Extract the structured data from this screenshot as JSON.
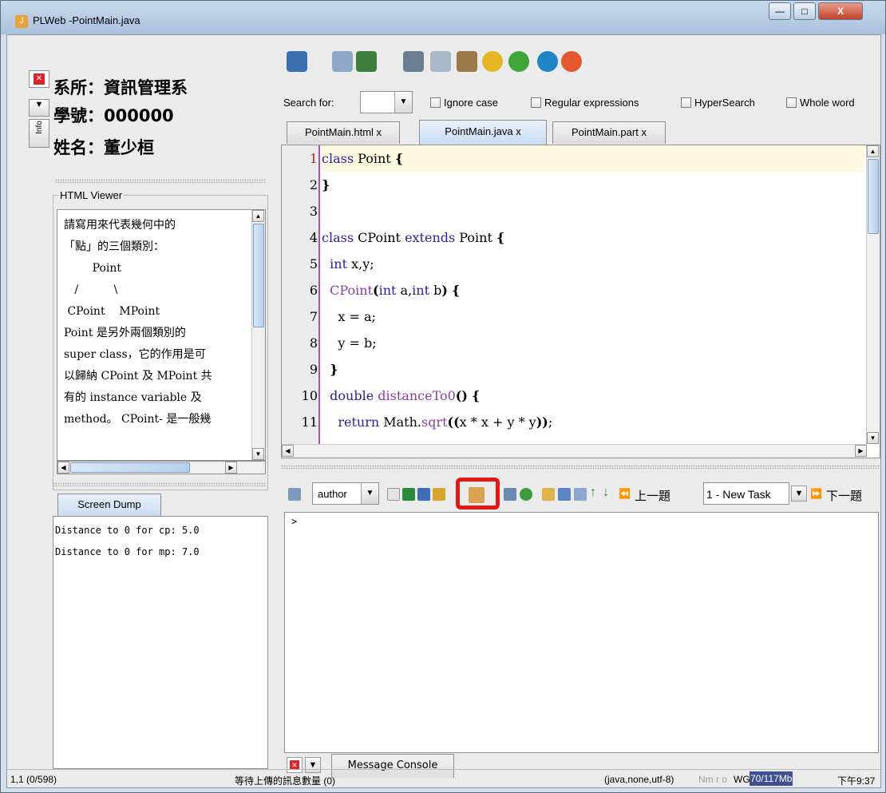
{
  "window": {
    "title": "PLWeb -PointMain.java",
    "min": "—",
    "max": "□",
    "close": "X"
  },
  "info": {
    "dept_label": "系所：",
    "dept": "資訊管理系",
    "id_label": "學號：",
    "id": "000000",
    "name_label": "姓名：",
    "name": "董少桓",
    "info_tab": "Info"
  },
  "html_viewer": {
    "label": "HTML Viewer",
    "lines": [
      "請寫用來代表幾何中的",
      "「點」的三個類別：",
      "        Point",
      "   /          \\",
      " CPoint    MPoint",
      "Point 是另外兩個類別的",
      "super class，它的作用是可",
      "以歸納 CPoint 及 MPoint 共",
      "有的 instance variable 及",
      "method。 CPoint- 是一般幾"
    ]
  },
  "screen_dump": {
    "tab": "Screen Dump",
    "lines": [
      "Distance to 0 for cp: 5.0",
      "Distance to 0 for mp: 7.0"
    ]
  },
  "search": {
    "label": "Search for:",
    "value": "",
    "options": [
      "Ignore case",
      "Regular expressions",
      "HyperSearch",
      "Whole word"
    ]
  },
  "editor_tabs": [
    {
      "label": "PointMain.html",
      "close": "x"
    },
    {
      "label": "PointMain.java",
      "close": "x"
    },
    {
      "label": "PointMain.part",
      "close": "x"
    }
  ],
  "code": [
    {
      "n": "1",
      "t": "class Point {"
    },
    {
      "n": "2",
      "t": "}"
    },
    {
      "n": "3",
      "t": ""
    },
    {
      "n": "4",
      "t": "class CPoint extends Point {"
    },
    {
      "n": "5",
      "t": "  int x,y;"
    },
    {
      "n": "6",
      "t": "  CPoint(int a,int b) {"
    },
    {
      "n": "7",
      "t": "    x = a;"
    },
    {
      "n": "8",
      "t": "    y = b;"
    },
    {
      "n": "9",
      "t": "  }"
    },
    {
      "n": "10",
      "t": "  double distanceTo0() {"
    },
    {
      "n": "11",
      "t": "    return Math.sqrt((x * x + y * y));"
    }
  ],
  "bottom_toolbar": {
    "role": "author",
    "prev": "上一題",
    "task": "1 - New Task",
    "next": "下一題"
  },
  "console": {
    "text": ">",
    "tab": "Message Console"
  },
  "status": {
    "pos": "1,1 (0/598)",
    "queue": "等待上傳的訊息數量 (0)",
    "mode": "(java,none,utf-8)",
    "flags": "Nm r o",
    "wg": "WG",
    "mem": "70/117Mb",
    "time": "下午9:37"
  },
  "colors": {
    "highlight_box": "#e01818",
    "gutter_line": "#b64db5",
    "current_line": "#fdf8df"
  }
}
